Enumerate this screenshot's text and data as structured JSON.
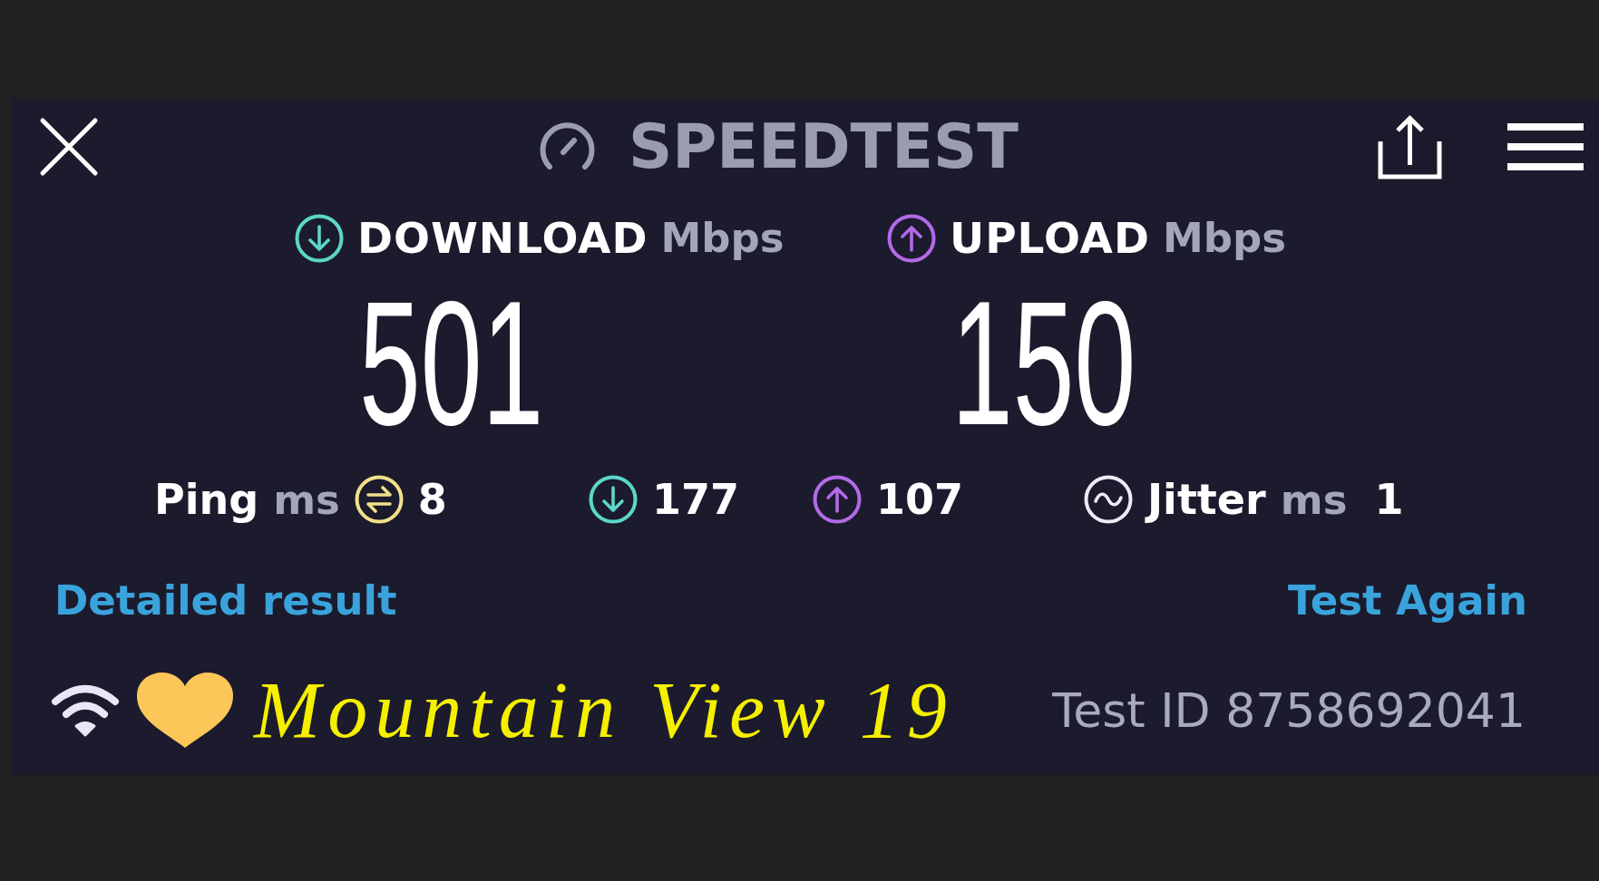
{
  "header": {
    "title": "SPEEDTEST"
  },
  "results": [
    {
      "kind": "download",
      "label": "DOWNLOAD",
      "unit": "Mbps",
      "value": "501"
    },
    {
      "kind": "upload",
      "label": "UPLOAD",
      "unit": "Mbps",
      "value": "150"
    }
  ],
  "stats": [
    {
      "kind": "ping",
      "label": "Ping",
      "unit": "ms",
      "value": "8"
    },
    {
      "kind": "download",
      "value": "177"
    },
    {
      "kind": "upload",
      "value": "107"
    },
    {
      "kind": "jitter",
      "label": "Jitter",
      "unit": "ms",
      "value": "1"
    }
  ],
  "links": [
    {
      "label": "Detailed result"
    },
    {
      "label": "Test Again"
    }
  ],
  "footer": {
    "network_name": "Mountain View 19",
    "test_id": "Test ID 8758692041"
  }
}
